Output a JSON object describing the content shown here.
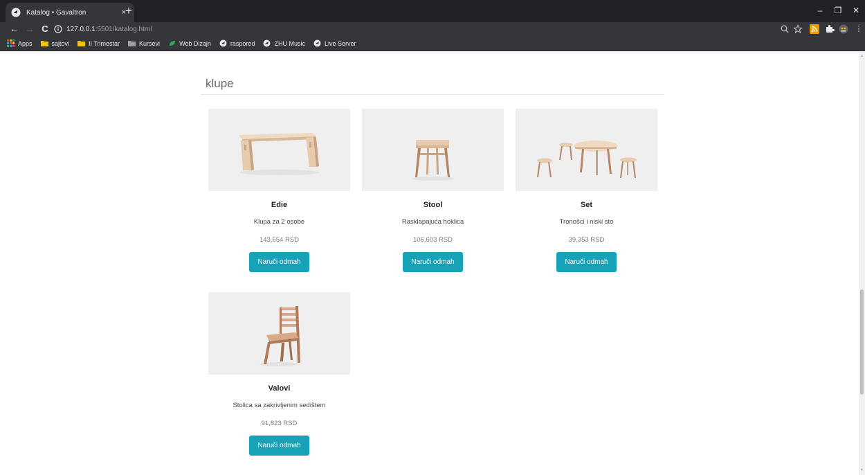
{
  "browser": {
    "tab_title": "Katalog • Gavaltron",
    "tab_close": "×",
    "new_tab": "+",
    "url_host": "127.0.0.1",
    "url_rest": ":5501/katalog.html",
    "window_controls": {
      "minimize": "–",
      "restore": "❐",
      "close": "✕"
    },
    "nav": {
      "back": "←",
      "forward": "→",
      "reload": "C"
    },
    "bookmarks": [
      {
        "label": "Apps",
        "icon": "apps-grid-icon",
        "color": "#ea4335"
      },
      {
        "label": "sajtovi",
        "icon": "folder-icon",
        "color": "#f4c20d"
      },
      {
        "label": "II Trimestar",
        "icon": "folder-icon",
        "color": "#f4c20d"
      },
      {
        "label": "Kursevi",
        "icon": "folder-icon",
        "color": "#9aa0a6"
      },
      {
        "label": "Web Dizajn",
        "icon": "leaf-icon",
        "color": "#34a853"
      },
      {
        "label": "raspored",
        "icon": "globe-icon",
        "color": "#e8eaed"
      },
      {
        "label": "ZHU Music",
        "icon": "globe-icon",
        "color": "#e8eaed"
      },
      {
        "label": "Live Server",
        "icon": "globe-icon",
        "color": "#e8eaed"
      }
    ]
  },
  "section": {
    "title": "klupe"
  },
  "products": [
    {
      "name": "Edie",
      "description": "Klupa za 2 osobe",
      "price": "143,554 RSD",
      "button": "Naruči odmah",
      "image_icon": "bench-icon"
    },
    {
      "name": "Stool",
      "description": "Rasklapajuća hoklica",
      "price": "106,603 RSD",
      "button": "Naruči odmah",
      "image_icon": "stool-icon"
    },
    {
      "name": "Set",
      "description": "Tronošci i niski sto",
      "price": "39,353 RSD",
      "button": "Naruči odmah",
      "image_icon": "table-set-icon"
    },
    {
      "name": "Valovi",
      "description": "Stolica sa zakrivljenim sedištem",
      "price": "91,823 RSD",
      "button": "Naruči odmah",
      "image_icon": "chair-icon"
    }
  ],
  "colors": {
    "button": "#17a2b8",
    "wood": "#e6cbae",
    "wood_dark": "#c9a482"
  }
}
